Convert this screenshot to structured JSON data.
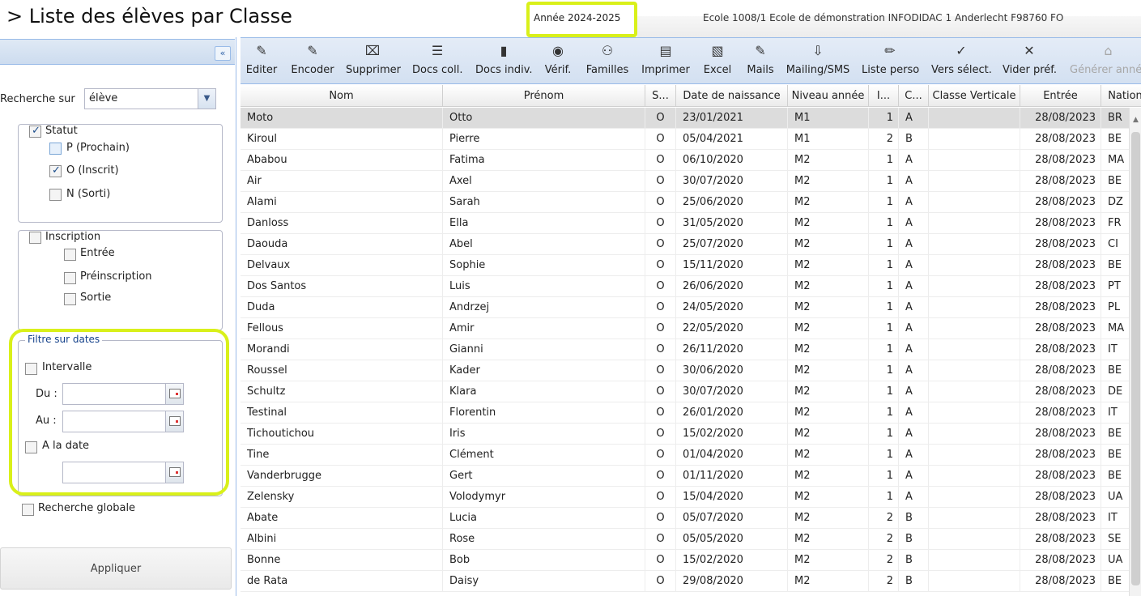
{
  "header": {
    "title": "> Liste des élèves par Classe",
    "year": "Année 2024-2025",
    "school": "Ecole 1008/1 Ecole de démonstration INFODIDAC 1 Anderlecht F98760 FO"
  },
  "left": {
    "collapse_icon": "«",
    "search_label": "Recherche sur",
    "search_value": "élève",
    "statut": {
      "label": "Statut",
      "checked": true,
      "items": [
        {
          "label": "P (Prochain)",
          "checked": false
        },
        {
          "label": "O (Inscrit)",
          "checked": true
        },
        {
          "label": "N (Sorti)",
          "checked": false
        }
      ]
    },
    "inscription": {
      "label": "Inscription",
      "checked": false,
      "items": [
        {
          "label": "Entrée",
          "checked": false
        },
        {
          "label": "Préinscription",
          "checked": false
        },
        {
          "label": "Sortie",
          "checked": false
        }
      ]
    },
    "date_filter": {
      "legend": "Filtre sur dates",
      "interval_label": "Intervalle",
      "from_label": "Du :",
      "to_label": "Au :",
      "from_value": "",
      "to_value": "",
      "at_date_label": "A la date",
      "at_date_value": ""
    },
    "global_search_label": "Recherche globale",
    "apply_label": "Appliquer"
  },
  "toolbar": [
    {
      "name": "edit",
      "label": "Editer",
      "icon": "edit-icon",
      "glyph": "✎"
    },
    {
      "name": "encode",
      "label": "Encoder",
      "icon": "encode-icon",
      "glyph": "✎"
    },
    {
      "name": "delete",
      "label": "Supprimer",
      "icon": "trash-icon",
      "glyph": "⌧"
    },
    {
      "name": "docs-coll",
      "label": "Docs coll.",
      "icon": "menu-icon",
      "glyph": "☰"
    },
    {
      "name": "docs-indiv",
      "label": "Docs indiv.",
      "icon": "book-icon",
      "glyph": "▮"
    },
    {
      "name": "verify",
      "label": "Vérif.",
      "icon": "eye-icon",
      "glyph": "◉"
    },
    {
      "name": "families",
      "label": "Familles",
      "icon": "family-icon",
      "glyph": "⚇"
    },
    {
      "name": "print",
      "label": "Imprimer",
      "icon": "print-icon",
      "glyph": "▤"
    },
    {
      "name": "excel",
      "label": "Excel",
      "icon": "excel-icon",
      "glyph": "▧"
    },
    {
      "name": "mails",
      "label": "Mails",
      "icon": "mail-icon",
      "glyph": "✎"
    },
    {
      "name": "mailing",
      "label": "Mailing/SMS",
      "icon": "inbox-icon",
      "glyph": "⇩"
    },
    {
      "name": "custom-list",
      "label": "Liste perso",
      "icon": "pencil-icon",
      "glyph": "✏"
    },
    {
      "name": "to-selection",
      "label": "Vers sélect.",
      "icon": "check-icon",
      "glyph": "✓"
    },
    {
      "name": "clear-pref",
      "label": "Vider préf.",
      "icon": "close-icon",
      "glyph": "✕"
    },
    {
      "name": "generate-year",
      "label": "Générer année",
      "icon": "generate-icon",
      "glyph": "⌂",
      "disabled": true
    }
  ],
  "grid": {
    "columns": [
      "Nom",
      "Prénom",
      "S...",
      "Date de naissance",
      "Niveau année",
      "I...",
      "C...",
      "Classe Verticale",
      "Entrée",
      "Nation"
    ],
    "rows": [
      [
        "Moto",
        "Otto",
        "O",
        "23/01/2021",
        "M1",
        "1",
        "A",
        "",
        "28/08/2023",
        "BR"
      ],
      [
        "Kiroul",
        "Pierre",
        "O",
        "05/04/2021",
        "M1",
        "2",
        "B",
        "",
        "28/08/2023",
        "BE"
      ],
      [
        "Ababou",
        "Fatima",
        "O",
        "06/10/2020",
        "M2",
        "1",
        "A",
        "",
        "28/08/2023",
        "MA"
      ],
      [
        "Air",
        "Axel",
        "O",
        "30/07/2020",
        "M2",
        "1",
        "A",
        "",
        "28/08/2023",
        "BE"
      ],
      [
        "Alami",
        "Sarah",
        "O",
        "25/06/2020",
        "M2",
        "1",
        "A",
        "",
        "28/08/2023",
        "DZ"
      ],
      [
        "Danloss",
        "Ella",
        "O",
        "31/05/2020",
        "M2",
        "1",
        "A",
        "",
        "28/08/2023",
        "FR"
      ],
      [
        "Daouda",
        "Abel",
        "O",
        "25/07/2020",
        "M2",
        "1",
        "A",
        "",
        "28/08/2023",
        "CI"
      ],
      [
        "Delvaux",
        "Sophie",
        "O",
        "15/11/2020",
        "M2",
        "1",
        "A",
        "",
        "28/08/2023",
        "BE"
      ],
      [
        "Dos Santos",
        "Luis",
        "O",
        "26/06/2020",
        "M2",
        "1",
        "A",
        "",
        "28/08/2023",
        "PT"
      ],
      [
        "Duda",
        "Andrzej",
        "O",
        "24/05/2020",
        "M2",
        "1",
        "A",
        "",
        "28/08/2023",
        "PL"
      ],
      [
        "Fellous",
        "Amir",
        "O",
        "22/05/2020",
        "M2",
        "1",
        "A",
        "",
        "28/08/2023",
        "MA"
      ],
      [
        "Morandi",
        "Gianni",
        "O",
        "26/11/2020",
        "M2",
        "1",
        "A",
        "",
        "28/08/2023",
        "IT"
      ],
      [
        "Roussel",
        "Kader",
        "O",
        "30/06/2020",
        "M2",
        "1",
        "A",
        "",
        "28/08/2023",
        "BE"
      ],
      [
        "Schultz",
        "Klara",
        "O",
        "30/07/2020",
        "M2",
        "1",
        "A",
        "",
        "28/08/2023",
        "DE"
      ],
      [
        "Testinal",
        "Florentin",
        "O",
        "26/01/2020",
        "M2",
        "1",
        "A",
        "",
        "28/08/2023",
        "IT"
      ],
      [
        "Tichoutichou",
        "Iris",
        "O",
        "15/02/2020",
        "M2",
        "1",
        "A",
        "",
        "28/08/2023",
        "BE"
      ],
      [
        "Tine",
        "Clément",
        "O",
        "01/04/2020",
        "M2",
        "1",
        "A",
        "",
        "28/08/2023",
        "BE"
      ],
      [
        "Vanderbrugge",
        "Gert",
        "O",
        "01/11/2020",
        "M2",
        "1",
        "A",
        "",
        "28/08/2023",
        "BE"
      ],
      [
        "Zelensky",
        "Volodymyr",
        "O",
        "15/04/2020",
        "M2",
        "1",
        "A",
        "",
        "28/08/2023",
        "UA"
      ],
      [
        "Abate",
        "Lucia",
        "O",
        "05/07/2020",
        "M2",
        "2",
        "B",
        "",
        "28/08/2023",
        "IT"
      ],
      [
        "Albini",
        "Rose",
        "O",
        "05/05/2020",
        "M2",
        "2",
        "B",
        "",
        "28/08/2023",
        "SE"
      ],
      [
        "Bonne",
        "Bob",
        "O",
        "15/02/2020",
        "M2",
        "2",
        "B",
        "",
        "28/08/2023",
        "UA"
      ],
      [
        "de Rata",
        "Daisy",
        "O",
        "29/08/2020",
        "M2",
        "2",
        "B",
        "",
        "28/08/2023",
        "BE"
      ]
    ],
    "selected_row": 0
  },
  "colors": {
    "highlight": "#d9f01a",
    "toolbar_bg": "#d3e0f1",
    "selected_row": "#dcdcdc"
  }
}
